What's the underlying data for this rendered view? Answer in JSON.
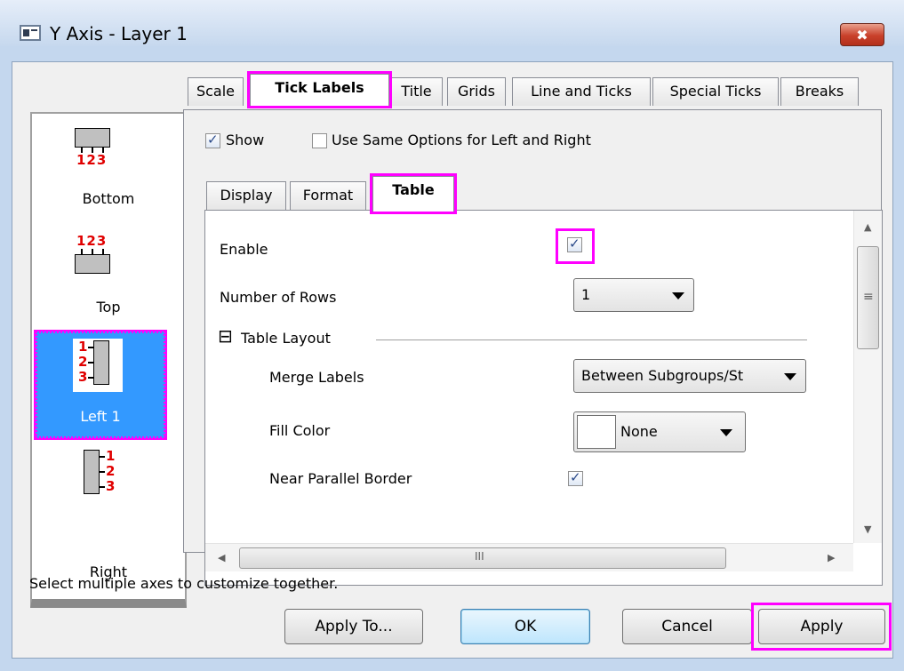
{
  "window": {
    "title": "Y Axis - Layer 1",
    "close_glyph": "✖"
  },
  "axis_list": {
    "items": [
      {
        "label": "Bottom",
        "numbers": "123"
      },
      {
        "label": "Top",
        "numbers": "123"
      },
      {
        "label": "Left 1",
        "numbers": [
          "1",
          "2",
          "3"
        ],
        "selected": true
      },
      {
        "label": "Right",
        "numbers": [
          "1",
          "2",
          "3"
        ]
      }
    ]
  },
  "main_tabs": [
    "Scale",
    "Tick Labels",
    "Title",
    "Grids",
    "Line and Ticks",
    "Special Ticks",
    "Breaks"
  ],
  "active_main_tab": "Tick Labels",
  "options": {
    "show_label": "Show",
    "show_checked": true,
    "same_options_label": "Use Same Options for Left and Right",
    "same_options_checked": false
  },
  "sub_tabs": [
    "Display",
    "Format",
    "Table"
  ],
  "active_sub_tab": "Table",
  "table": {
    "enable_label": "Enable",
    "enable_checked": true,
    "rows_label": "Number of Rows",
    "rows_value": "1",
    "layout_group": "Table Layout",
    "layout_toggle": "⊟",
    "merge_label": "Merge Labels",
    "merge_value": "Between Subgroups/St",
    "fill_label": "Fill Color",
    "fill_value": "None",
    "border_label": "Near Parallel Border",
    "border_checked": true
  },
  "scrollbars": {
    "grip": "≡",
    "h_grip": "III"
  },
  "status_hint": "Select multiple axes to customize together.",
  "buttons": {
    "apply_to": "Apply To...",
    "ok": "OK",
    "cancel": "Cancel",
    "apply": "Apply"
  },
  "colors": {
    "highlight": "#ff00ff",
    "selection": "#3399ff",
    "axis_numbers": "#e00000"
  }
}
